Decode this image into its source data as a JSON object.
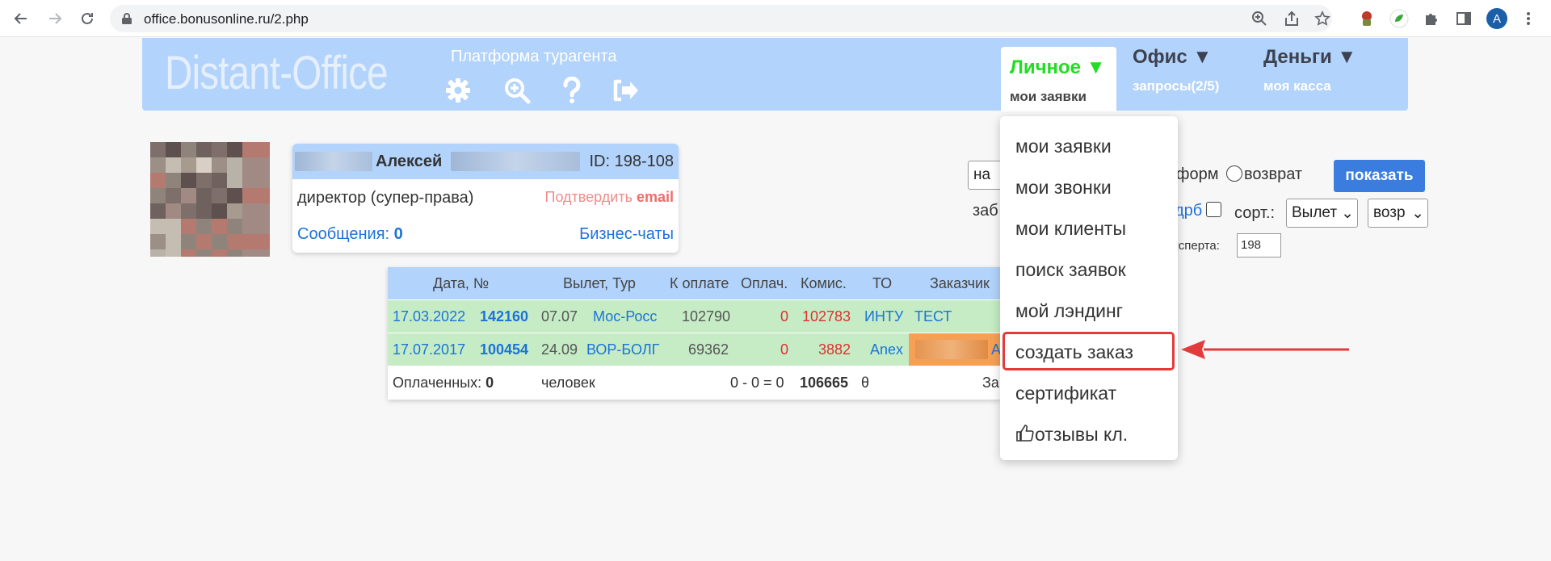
{
  "browser": {
    "url": "office.bonusonline.ru/2.php",
    "profile_initial": "A"
  },
  "header": {
    "logo": "Distant-Office",
    "platform_text": "Платформа турагента",
    "menus": [
      {
        "title": "Личное ▼",
        "sub": "мои заявки"
      },
      {
        "title": "Офис ▼",
        "sub": "запросы(2/5)"
      },
      {
        "title": "Деньги ▼",
        "sub": "моя касса"
      }
    ]
  },
  "profile": {
    "name": "Алексей",
    "id": "ID: 198-108",
    "role": "директор (супер-права)",
    "confirm_prefix": "Подтвердить",
    "confirm_bold": "email",
    "messages_label": "Сообщения:",
    "messages_count": "0",
    "business_chats": "Бизнес-чаты"
  },
  "orders_table": {
    "headers": [
      "Дата, №",
      "Вылет, Тур",
      "К оплате",
      "Оплач.",
      "Комис.",
      "ТО",
      "Заказчик"
    ],
    "rows": [
      {
        "date": "17.03.2022",
        "num": "142160",
        "dep": "07.07",
        "tour": "Мос-Росс",
        "to_pay": "102790",
        "paid": "0",
        "comm": "102783",
        "to": "ИНТУ",
        "client": "ТЕСТ"
      },
      {
        "date": "17.07.2017",
        "num": "100454",
        "dep": "24.09",
        "tour": "ВОР-БОЛГ",
        "to_pay": "69362",
        "paid": "0",
        "comm": "3882",
        "to": "Anex",
        "client": "А"
      }
    ],
    "footer": {
      "paid_label": "Оплаченных:",
      "paid_count": "0",
      "people": "человек",
      "formula": "0 - 0 = 0",
      "total": "106665",
      "currency": "θ",
      "tail": "За"
    }
  },
  "filters": {
    "select1": "на",
    "radio1_label": "форм",
    "radio2_label": "возврат",
    "show_button": "показать",
    "zab_text": "заб",
    "drb_text": "дрб",
    "sort_label": "сорт.:",
    "sort_select": "Вылет",
    "order_select": "возр",
    "expert_label": "ксперта:",
    "expert_value": "198"
  },
  "dropdown": {
    "items": [
      "мои заявки",
      "мои звонки",
      "мои клиенты",
      "поиск заявок",
      "мой лэндинг",
      "создать заказ",
      "сертификат",
      "отзывы кл."
    ],
    "highlighted_index": 5
  },
  "colors": {
    "header_bg": "#b2d3fb",
    "active_menu": "#22dd22",
    "row_green": "#c5ecc5",
    "link_blue": "#1c73d9",
    "highlight_red": "#e23b3b",
    "button_blue": "#3b7dde"
  }
}
